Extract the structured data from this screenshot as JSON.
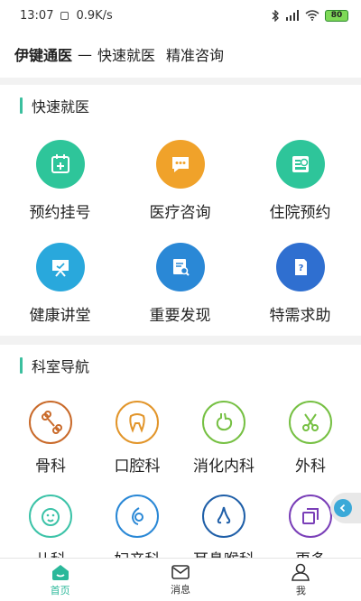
{
  "status": {
    "time": "13:07",
    "net_speed": "0.9K/s",
    "battery": "80"
  },
  "header": {
    "brand": "伊键通医",
    "dash": "—",
    "sub1": "快速就医",
    "sub2": "精准咨询"
  },
  "quick": {
    "title": "快速就医",
    "items": [
      {
        "label": "预约挂号",
        "icon": "calendar-plus-icon",
        "color": "#2ec59a"
      },
      {
        "label": "医疗咨询",
        "icon": "chat-bubble-icon",
        "color": "#f0a22a"
      },
      {
        "label": "住院预约",
        "icon": "bed-clock-icon",
        "color": "#2ec59a"
      },
      {
        "label": "健康讲堂",
        "icon": "presentation-board-icon",
        "color": "#29a8dc"
      },
      {
        "label": "重要发现",
        "icon": "document-search-icon",
        "color": "#2a88d6"
      },
      {
        "label": "特需求助",
        "icon": "help-document-icon",
        "color": "#2f6fd0"
      }
    ]
  },
  "dept": {
    "title": "科室导航",
    "items": [
      {
        "label": "骨科",
        "icon": "bone-icon",
        "color": "#c96a2a"
      },
      {
        "label": "口腔科",
        "icon": "tooth-icon",
        "color": "#e2952a"
      },
      {
        "label": "消化内科",
        "icon": "stomach-icon",
        "color": "#76c043"
      },
      {
        "label": "外科",
        "icon": "scissors-icon",
        "color": "#76c043"
      },
      {
        "label": "儿科",
        "icon": "baby-face-icon",
        "color": "#3cc3a8"
      },
      {
        "label": "妇产科",
        "icon": "fetus-icon",
        "color": "#2a88d6"
      },
      {
        "label": "耳鼻喉科",
        "icon": "nose-icon",
        "color": "#1f5fa8"
      },
      {
        "label": "更多",
        "icon": "more-squares-icon",
        "color": "#7a3fb8"
      }
    ]
  },
  "tabs": [
    {
      "label": "首页",
      "icon": "home-icon"
    },
    {
      "label": "消息",
      "icon": "mail-icon"
    },
    {
      "label": "我",
      "icon": "user-icon"
    }
  ]
}
